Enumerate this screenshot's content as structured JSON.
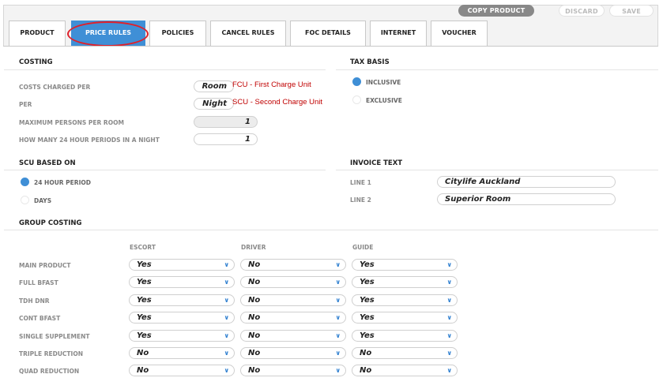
{
  "toolbar": {
    "copy": "COPY PRODUCT",
    "discard": "DISCARD",
    "save": "SAVE"
  },
  "tabs": [
    "PRODUCT",
    "PRICE RULES",
    "POLICIES",
    "CANCEL RULES",
    "FOC DETAILS",
    "INTERNET",
    "VOUCHER"
  ],
  "active_tab": "PRICE RULES",
  "costing": {
    "title": "COSTING",
    "costs_charged_per": {
      "label": "COSTS CHARGED PER",
      "value": "Room",
      "note": "FCU - First Charge Unit"
    },
    "per": {
      "label": "PER",
      "value": "Night",
      "note": "SCU - Second Charge Unit"
    },
    "max_persons": {
      "label": "MAXIMUM PERSONS PER ROOM",
      "value": "1"
    },
    "periods": {
      "label": "HOW MANY 24 HOUR PERIODS IN A NIGHT",
      "value": "1"
    }
  },
  "tax_basis": {
    "title": "TAX BASIS",
    "options": [
      "INCLUSIVE",
      "EXCLUSIVE"
    ],
    "selected": "INCLUSIVE"
  },
  "scu_based_on": {
    "title": "SCU BASED ON",
    "options": [
      "24 HOUR PERIOD",
      "DAYS"
    ],
    "selected": "24 HOUR PERIOD"
  },
  "invoice_text": {
    "title": "INVOICE TEXT",
    "line1_label": "LINE 1",
    "line1": "Citylife Auckland",
    "line2_label": "LINE 2",
    "line2": "Superior Room"
  },
  "group_costing": {
    "title": "GROUP COSTING",
    "columns": [
      "ESCORT",
      "DRIVER",
      "GUIDE"
    ],
    "rows": [
      {
        "label": "MAIN PRODUCT",
        "values": [
          "Yes",
          "No",
          "Yes"
        ]
      },
      {
        "label": "FULL BFAST",
        "values": [
          "Yes",
          "No",
          "Yes"
        ]
      },
      {
        "label": "TDH DNR",
        "values": [
          "Yes",
          "No",
          "Yes"
        ]
      },
      {
        "label": "CONT BFAST",
        "values": [
          "Yes",
          "No",
          "Yes"
        ]
      },
      {
        "label": "SINGLE SUPPLEMENT",
        "values": [
          "Yes",
          "No",
          "Yes"
        ]
      },
      {
        "label": "TRIPLE REDUCTION",
        "values": [
          "No",
          "No",
          "No"
        ]
      },
      {
        "label": "QUAD REDUCTION",
        "values": [
          "No",
          "No",
          "No"
        ]
      }
    ]
  },
  "colors": {
    "accent": "#3f8fd6",
    "highlight": "#e0202a",
    "note": "#c00000"
  },
  "icons": {
    "select_arrow": "chevron-down-icon"
  }
}
